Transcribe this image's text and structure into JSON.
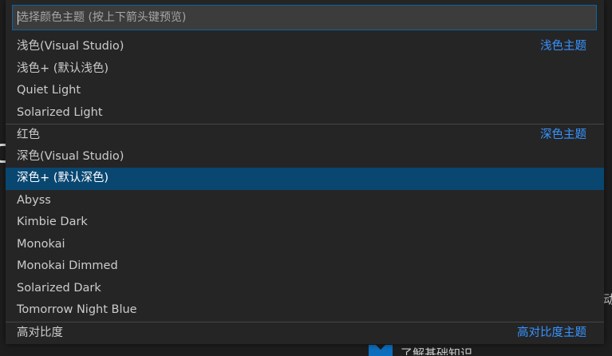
{
  "quick_pick": {
    "placeholder": "选择颜色主题 (按上下箭头键预览)",
    "value": "",
    "selected_index": 6,
    "items": [
      {
        "label": "浅色(Visual Studio)",
        "group": "浅色主题",
        "separator": false
      },
      {
        "label": "浅色+ (默认浅色)",
        "group": "",
        "separator": false
      },
      {
        "label": "Quiet Light",
        "group": "",
        "separator": false
      },
      {
        "label": "Solarized Light",
        "group": "",
        "separator": false
      },
      {
        "label": "红色",
        "group": "深色主题",
        "separator": true
      },
      {
        "label": "深色(Visual Studio)",
        "group": "",
        "separator": false
      },
      {
        "label": "深色+ (默认深色)",
        "group": "",
        "separator": false
      },
      {
        "label": "Abyss",
        "group": "",
        "separator": false
      },
      {
        "label": "Kimbie Dark",
        "group": "",
        "separator": false
      },
      {
        "label": "Monokai",
        "group": "",
        "separator": false
      },
      {
        "label": "Monokai Dimmed",
        "group": "",
        "separator": false
      },
      {
        "label": "Solarized Dark",
        "group": "",
        "separator": false
      },
      {
        "label": "Tomorrow Night Blue",
        "group": "",
        "separator": false
      },
      {
        "label": "高对比度",
        "group": "高对比度主题",
        "separator": true
      }
    ]
  },
  "background": {
    "right_edge_text": "动",
    "bottom_text": "了解基础知识"
  },
  "colors": {
    "widget_background": "#252526",
    "input_background": "#3c3c3c",
    "focus_border": "#0e639c",
    "selected_row": "#094771",
    "group_label": "#3794ff",
    "item_text": "#cccccc"
  }
}
